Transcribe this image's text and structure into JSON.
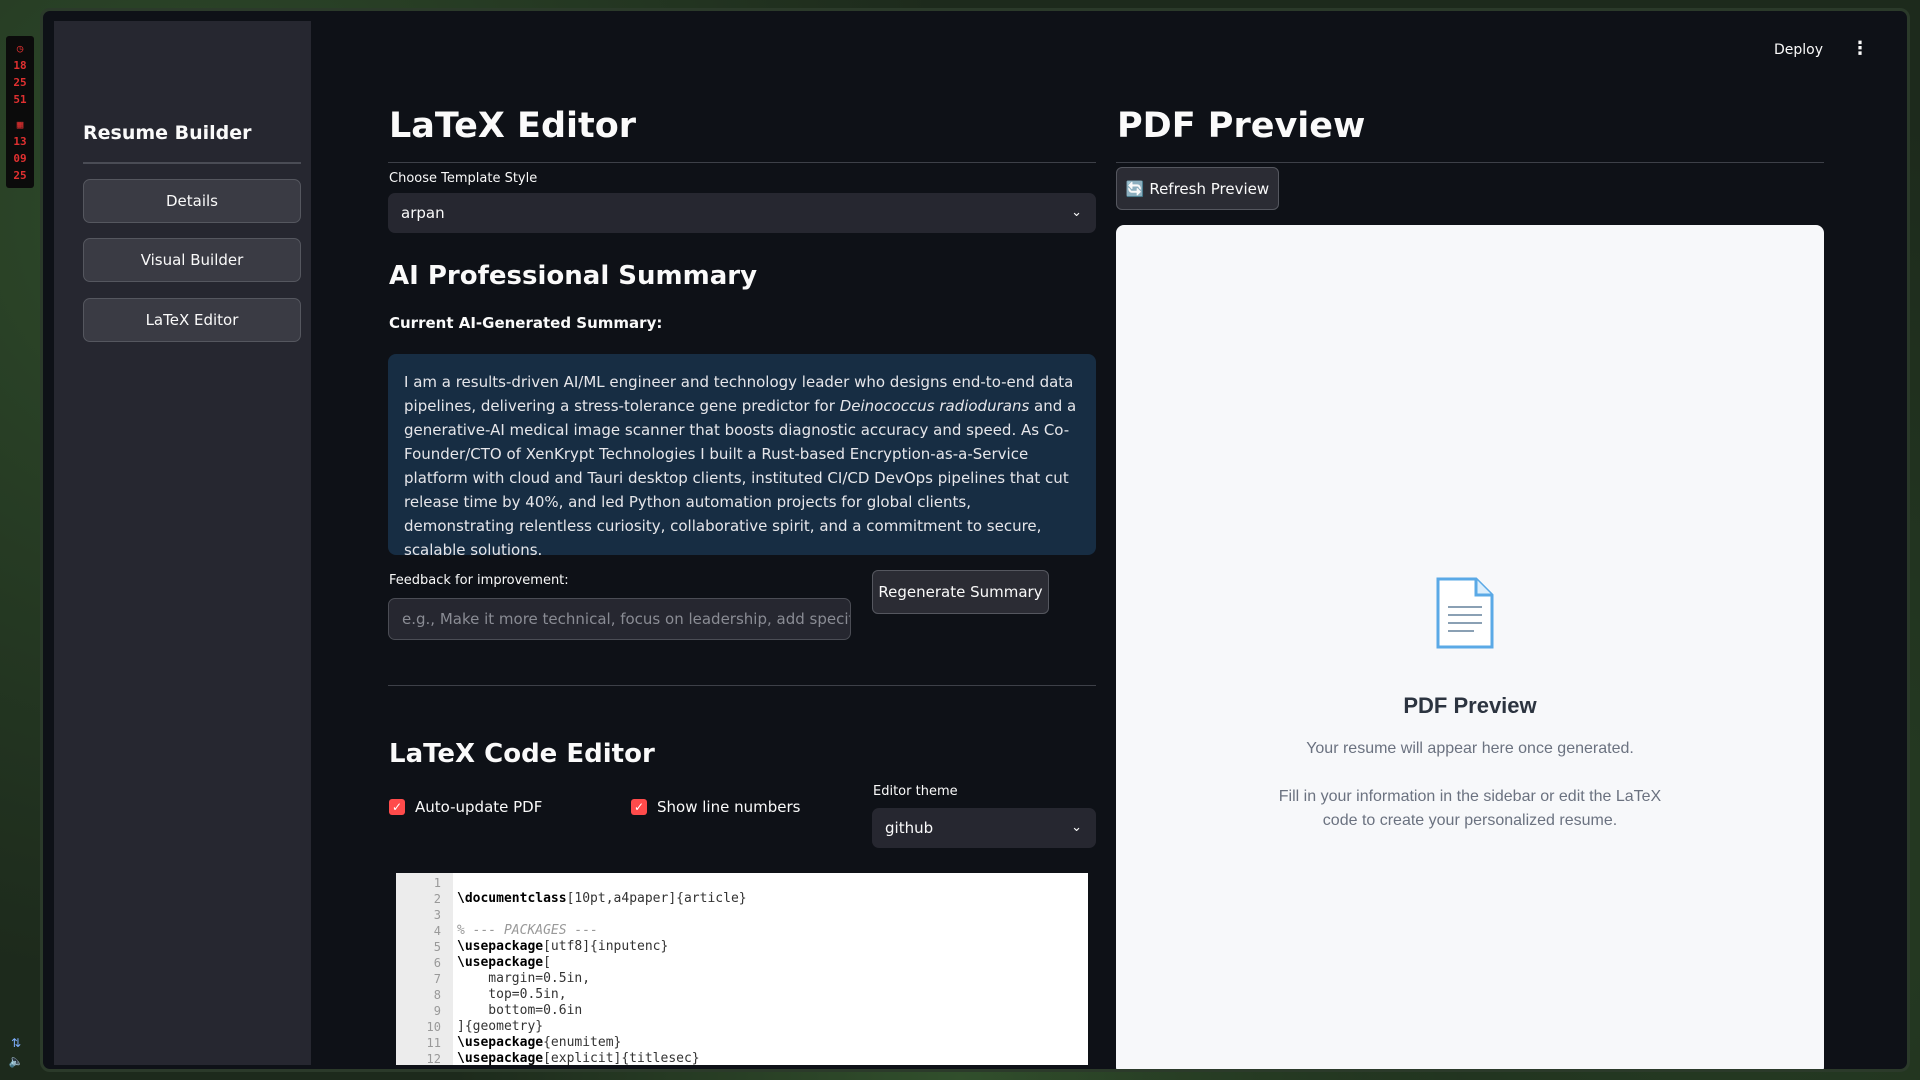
{
  "desktop": {
    "clock": [
      "18",
      "25",
      "51"
    ],
    "date": [
      "13",
      "09",
      "25"
    ]
  },
  "sidebar": {
    "title": "Resume Builder",
    "items": [
      {
        "label": "Details"
      },
      {
        "label": "Visual Builder"
      },
      {
        "label": "LaTeX Editor"
      }
    ]
  },
  "topbar": {
    "deploy_label": "Deploy",
    "menu_icon": "⋮"
  },
  "editor": {
    "title": "LaTeX Editor",
    "template_label": "Choose Template Style",
    "template_value": "arpan",
    "ai_section_title": "AI Professional Summary",
    "current_label": "Current AI-Generated Summary:",
    "summary_pre": "I am a results-driven AI/ML engineer and technology leader who designs end-to-end data pipelines, delivering a stress-tolerance gene predictor for ",
    "summary_em": "Deinococcus radiodurans",
    "summary_post": " and a generative-AI medical image scanner that boosts diagnostic accuracy and speed. As Co-Founder/CTO of XenKrypt Technologies I built a Rust-based Encryption-as-a-Service platform with cloud and Tauri desktop clients, instituted CI/CD DevOps pipelines that cut release time by 40%, and led Python automation projects for global clients, demonstrating relentless curiosity, collaborative spirit, and a commitment to secure, scalable solutions.",
    "feedback_label": "Feedback for improvement:",
    "feedback_placeholder": "e.g., Make it more technical, focus on leadership, add specific skills",
    "regenerate_label": "Regenerate Summary",
    "code_section_title": "LaTeX Code Editor",
    "auto_update_label": "Auto-update PDF",
    "line_numbers_label": "Show line numbers",
    "theme_label": "Editor theme",
    "theme_value": "github",
    "code_lines": [
      {
        "n": "1",
        "kw": "",
        "rest": "",
        "cm": ""
      },
      {
        "n": "2",
        "kw": "\\documentclass",
        "rest": "[10pt,a4paper]{article}",
        "cm": ""
      },
      {
        "n": "3",
        "kw": "",
        "rest": "",
        "cm": ""
      },
      {
        "n": "4",
        "kw": "",
        "rest": "",
        "cm": "% --- PACKAGES ---"
      },
      {
        "n": "5",
        "kw": "\\usepackage",
        "rest": "[utf8]{inputenc}",
        "cm": ""
      },
      {
        "n": "6",
        "kw": "\\usepackage",
        "rest": "[",
        "cm": ""
      },
      {
        "n": "7",
        "kw": "",
        "rest": "    margin=0.5in,",
        "cm": ""
      },
      {
        "n": "8",
        "kw": "",
        "rest": "    top=0.5in,",
        "cm": ""
      },
      {
        "n": "9",
        "kw": "",
        "rest": "    bottom=0.6in",
        "cm": ""
      },
      {
        "n": "10",
        "kw": "",
        "rest": "]{geometry}",
        "cm": ""
      },
      {
        "n": "11",
        "kw": "\\usepackage",
        "rest": "{enumitem}",
        "cm": ""
      },
      {
        "n": "12",
        "kw": "\\usepackage",
        "rest": "[explicit]{titlesec}",
        "cm": ""
      }
    ]
  },
  "preview": {
    "title": "PDF Preview",
    "refresh_label": "🔄 Refresh Preview",
    "placeholder_title": "PDF Preview",
    "placeholder_line1": "Your resume will appear here once generated.",
    "placeholder_line2": "Fill in your information in the sidebar or edit the LaTeX",
    "placeholder_line3": "code to create your personalized resume."
  },
  "colors": {
    "accent": "#ff4b4b",
    "summary_bg": "#172d43",
    "app_bg": "#0e1117",
    "sidebar_bg": "#262730"
  }
}
